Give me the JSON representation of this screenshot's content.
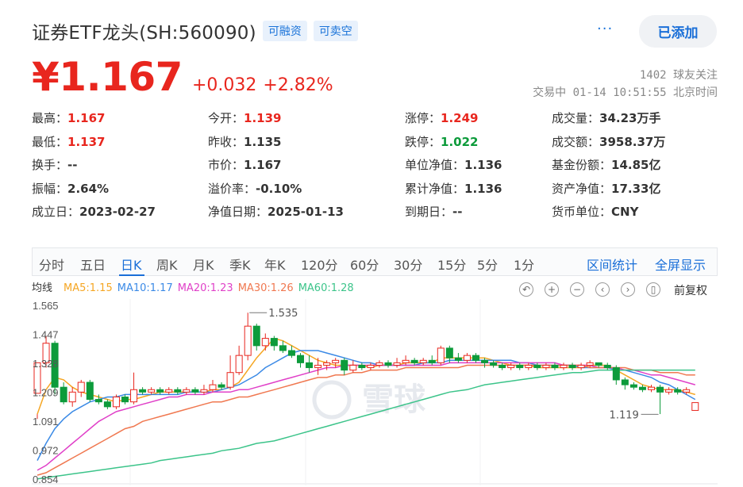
{
  "header": {
    "title": "证券ETF龙头(SH:560090)",
    "tags": [
      "可融资",
      "可卖空"
    ],
    "more": "···",
    "added_label": "已添加",
    "price": "¥1.167",
    "change": "+0.032",
    "change_pct": "+2.82%",
    "followers": "1402 球友关注",
    "status_time": "交易中 01-14 10:51:55 北京时间"
  },
  "stats": [
    {
      "label": "最高：",
      "value": "1.167",
      "color": "up"
    },
    {
      "label": "今开：",
      "value": "1.139",
      "color": "up"
    },
    {
      "label": "涨停：",
      "value": "1.249",
      "color": "up"
    },
    {
      "label": "成交量：",
      "value": "34.23万手",
      "color": ""
    },
    {
      "label": "最低：",
      "value": "1.137",
      "color": "up"
    },
    {
      "label": "昨收：",
      "value": "1.135",
      "color": ""
    },
    {
      "label": "跌停：",
      "value": "1.022",
      "color": "down"
    },
    {
      "label": "成交额：",
      "value": "3958.37万",
      "color": ""
    },
    {
      "label": "换手：",
      "value": "--",
      "color": ""
    },
    {
      "label": "市价：",
      "value": "1.167",
      "color": ""
    },
    {
      "label": "单位净值：",
      "value": "1.136",
      "color": ""
    },
    {
      "label": "基金份额：",
      "value": "14.85亿",
      "color": ""
    },
    {
      "label": "振幅：",
      "value": "2.64%",
      "color": ""
    },
    {
      "label": "溢价率：",
      "value": "-0.10%",
      "color": ""
    },
    {
      "label": "累计净值：",
      "value": "1.136",
      "color": ""
    },
    {
      "label": "资产净值：",
      "value": "17.33亿",
      "color": ""
    },
    {
      "label": "成立日：",
      "value": "2023-02-27",
      "color": ""
    },
    {
      "label": "净值日期：",
      "value": "2025-01-13",
      "color": ""
    },
    {
      "label": "到期日：",
      "value": "--",
      "color": ""
    },
    {
      "label": "货币单位：",
      "value": "CNY",
      "color": ""
    }
  ],
  "tabs": [
    "分时",
    "五日",
    "日K",
    "周K",
    "月K",
    "季K",
    "年K",
    "120分",
    "60分",
    "30分",
    "15分",
    "5分",
    "1分"
  ],
  "active_tab": 2,
  "tab_actions": [
    "区间统计",
    "全屏显示"
  ],
  "ma_legend": {
    "label": "均线",
    "items": [
      {
        "text": "MA5:1.15",
        "color": "#f5a623"
      },
      {
        "text": "MA10:1.17",
        "color": "#3b8ae6"
      },
      {
        "text": "MA20:1.23",
        "color": "#e040c8"
      },
      {
        "text": "MA30:1.26",
        "color": "#f07850"
      },
      {
        "text": "MA60:1.28",
        "color": "#3cc48a"
      }
    ]
  },
  "chart_tools": [
    "↶",
    "+",
    "−",
    "‹",
    "›",
    "▯"
  ],
  "restore_label": "前复权",
  "watermark": "雪球",
  "colors": {
    "up": "#e8261e",
    "down": "#0d9b3b",
    "accent": "#1a6fd8"
  },
  "chart_data": {
    "type": "candlestick",
    "y_ticks": [
      "1.565",
      "1.447",
      "1.328",
      "1.209",
      "1.091",
      "0.972",
      "0.854"
    ],
    "y_tick_values": [
      1.565,
      1.447,
      1.328,
      1.209,
      1.091,
      0.972,
      0.854
    ],
    "ylim": [
      0.854,
      1.565
    ],
    "annotations": [
      {
        "text": "1.535",
        "value": 1.535,
        "candle": 24
      },
      {
        "text": "1.119",
        "value": 1.119,
        "candle": 71
      }
    ],
    "candles": [
      [
        1.205,
        1.33,
        1.12,
        1.1
      ],
      [
        1.33,
        1.41,
        1.44,
        1.31
      ],
      [
        1.41,
        1.23,
        1.42,
        1.2
      ],
      [
        1.23,
        1.17,
        1.25,
        1.16
      ],
      [
        1.17,
        1.21,
        1.23,
        1.15
      ],
      [
        1.21,
        1.25,
        1.26,
        1.19
      ],
      [
        1.25,
        1.18,
        1.26,
        1.17
      ],
      [
        1.18,
        1.17,
        1.2,
        1.16
      ],
      [
        1.17,
        1.15,
        1.18,
        1.14
      ],
      [
        1.15,
        1.19,
        1.2,
        1.14
      ],
      [
        1.19,
        1.17,
        1.2,
        1.16
      ],
      [
        1.17,
        1.22,
        1.29,
        1.16
      ],
      [
        1.22,
        1.21,
        1.23,
        1.2
      ],
      [
        1.21,
        1.22,
        1.23,
        1.2
      ],
      [
        1.22,
        1.21,
        1.23,
        1.2
      ],
      [
        1.21,
        1.22,
        1.23,
        1.2
      ],
      [
        1.22,
        1.21,
        1.23,
        1.2
      ],
      [
        1.21,
        1.22,
        1.23,
        1.2
      ],
      [
        1.22,
        1.21,
        1.23,
        1.2
      ],
      [
        1.21,
        1.22,
        1.24,
        1.2
      ],
      [
        1.22,
        1.24,
        1.26,
        1.21
      ],
      [
        1.24,
        1.23,
        1.25,
        1.22
      ],
      [
        1.23,
        1.29,
        1.36,
        1.22
      ],
      [
        1.29,
        1.36,
        1.4,
        1.28
      ],
      [
        1.36,
        1.48,
        1.535,
        1.34
      ],
      [
        1.48,
        1.4,
        1.49,
        1.38
      ],
      [
        1.4,
        1.43,
        1.45,
        1.38
      ],
      [
        1.43,
        1.4,
        1.44,
        1.38
      ],
      [
        1.4,
        1.38,
        1.42,
        1.37
      ],
      [
        1.38,
        1.36,
        1.4,
        1.35
      ],
      [
        1.36,
        1.33,
        1.37,
        1.31
      ],
      [
        1.33,
        1.31,
        1.36,
        1.29
      ],
      [
        1.31,
        1.32,
        1.35,
        1.28
      ],
      [
        1.32,
        1.33,
        1.34,
        1.3
      ],
      [
        1.33,
        1.34,
        1.35,
        1.31
      ],
      [
        1.34,
        1.3,
        1.35,
        1.28
      ],
      [
        1.3,
        1.32,
        1.34,
        1.29
      ],
      [
        1.32,
        1.31,
        1.33,
        1.3
      ],
      [
        1.31,
        1.32,
        1.33,
        1.3
      ],
      [
        1.32,
        1.33,
        1.34,
        1.31
      ],
      [
        1.33,
        1.32,
        1.34,
        1.31
      ],
      [
        1.32,
        1.33,
        1.35,
        1.31
      ],
      [
        1.33,
        1.34,
        1.36,
        1.32
      ],
      [
        1.34,
        1.33,
        1.35,
        1.32
      ],
      [
        1.33,
        1.34,
        1.35,
        1.32
      ],
      [
        1.34,
        1.33,
        1.36,
        1.32
      ],
      [
        1.33,
        1.39,
        1.4,
        1.32
      ],
      [
        1.39,
        1.35,
        1.4,
        1.33
      ],
      [
        1.35,
        1.34,
        1.37,
        1.33
      ],
      [
        1.34,
        1.36,
        1.37,
        1.33
      ],
      [
        1.36,
        1.34,
        1.37,
        1.33
      ],
      [
        1.34,
        1.33,
        1.35,
        1.31
      ],
      [
        1.33,
        1.32,
        1.34,
        1.31
      ],
      [
        1.32,
        1.31,
        1.33,
        1.3
      ],
      [
        1.31,
        1.32,
        1.33,
        1.3
      ],
      [
        1.32,
        1.31,
        1.33,
        1.3
      ],
      [
        1.31,
        1.32,
        1.33,
        1.3
      ],
      [
        1.32,
        1.31,
        1.33,
        1.3
      ],
      [
        1.31,
        1.32,
        1.33,
        1.3
      ],
      [
        1.32,
        1.31,
        1.33,
        1.3
      ],
      [
        1.31,
        1.32,
        1.33,
        1.3
      ],
      [
        1.32,
        1.31,
        1.33,
        1.3
      ],
      [
        1.31,
        1.32,
        1.33,
        1.3
      ],
      [
        1.32,
        1.33,
        1.34,
        1.31
      ],
      [
        1.33,
        1.32,
        1.33,
        1.31
      ],
      [
        1.32,
        1.31,
        1.33,
        1.3
      ],
      [
        1.31,
        1.26,
        1.32,
        1.24
      ],
      [
        1.26,
        1.24,
        1.27,
        1.22
      ],
      [
        1.24,
        1.23,
        1.25,
        1.22
      ],
      [
        1.23,
        1.22,
        1.24,
        1.21
      ],
      [
        1.22,
        1.23,
        1.24,
        1.21
      ],
      [
        1.23,
        1.21,
        1.24,
        1.12
      ],
      [
        1.21,
        1.22,
        1.23,
        1.2
      ],
      [
        1.22,
        1.21,
        1.23,
        1.2
      ],
      [
        1.21,
        1.22,
        1.23,
        1.2
      ],
      [
        1.135,
        1.167,
        1.167,
        1.137
      ]
    ],
    "series": [
      {
        "name": "MA5",
        "color": "#f5a623",
        "values": [
          1.12,
          1.22,
          1.27,
          1.26,
          1.23,
          1.21,
          1.2,
          1.19,
          1.18,
          1.17,
          1.18,
          1.18,
          1.19,
          1.2,
          1.21,
          1.21,
          1.21,
          1.21,
          1.21,
          1.21,
          1.22,
          1.22,
          1.23,
          1.25,
          1.3,
          1.35,
          1.39,
          1.43,
          1.42,
          1.4,
          1.38,
          1.36,
          1.34,
          1.33,
          1.32,
          1.32,
          1.32,
          1.32,
          1.31,
          1.32,
          1.32,
          1.32,
          1.33,
          1.33,
          1.33,
          1.33,
          1.35,
          1.35,
          1.35,
          1.35,
          1.35,
          1.35,
          1.34,
          1.33,
          1.32,
          1.32,
          1.32,
          1.31,
          1.31,
          1.31,
          1.31,
          1.31,
          1.31,
          1.32,
          1.32,
          1.32,
          1.3,
          1.28,
          1.26,
          1.24,
          1.23,
          1.22,
          1.22,
          1.22,
          1.21,
          1.2
        ]
      },
      {
        "name": "MA10",
        "color": "#3b8ae6",
        "values": [
          0.93,
          1.0,
          1.06,
          1.1,
          1.13,
          1.15,
          1.17,
          1.18,
          1.19,
          1.19,
          1.2,
          1.2,
          1.2,
          1.2,
          1.2,
          1.2,
          1.2,
          1.21,
          1.21,
          1.21,
          1.21,
          1.22,
          1.23,
          1.24,
          1.26,
          1.28,
          1.31,
          1.33,
          1.35,
          1.37,
          1.38,
          1.38,
          1.38,
          1.37,
          1.36,
          1.35,
          1.34,
          1.33,
          1.33,
          1.32,
          1.32,
          1.32,
          1.32,
          1.32,
          1.33,
          1.33,
          1.33,
          1.34,
          1.34,
          1.34,
          1.34,
          1.34,
          1.34,
          1.34,
          1.34,
          1.33,
          1.33,
          1.32,
          1.32,
          1.32,
          1.32,
          1.32,
          1.31,
          1.31,
          1.31,
          1.31,
          1.3,
          1.3,
          1.29,
          1.28,
          1.27,
          1.25,
          1.24,
          1.22,
          1.2,
          1.18
        ]
      },
      {
        "name": "MA20",
        "color": "#e040c8",
        "values": [
          0.89,
          0.91,
          0.94,
          0.97,
          1.0,
          1.03,
          1.06,
          1.09,
          1.11,
          1.13,
          1.14,
          1.15,
          1.16,
          1.17,
          1.18,
          1.19,
          1.19,
          1.2,
          1.2,
          1.2,
          1.21,
          1.21,
          1.21,
          1.22,
          1.22,
          1.23,
          1.24,
          1.25,
          1.26,
          1.27,
          1.28,
          1.29,
          1.3,
          1.31,
          1.31,
          1.32,
          1.32,
          1.32,
          1.32,
          1.32,
          1.32,
          1.32,
          1.32,
          1.32,
          1.32,
          1.32,
          1.32,
          1.33,
          1.33,
          1.33,
          1.33,
          1.33,
          1.33,
          1.33,
          1.33,
          1.33,
          1.33,
          1.33,
          1.33,
          1.33,
          1.32,
          1.32,
          1.32,
          1.32,
          1.31,
          1.31,
          1.31,
          1.3,
          1.3,
          1.29,
          1.28,
          1.28,
          1.27,
          1.26,
          1.25,
          1.24
        ]
      },
      {
        "name": "MA30",
        "color": "#f07850",
        "values": [
          0.87,
          0.88,
          0.9,
          0.92,
          0.94,
          0.96,
          0.98,
          1.0,
          1.02,
          1.04,
          1.06,
          1.07,
          1.09,
          1.1,
          1.11,
          1.12,
          1.13,
          1.14,
          1.15,
          1.16,
          1.17,
          1.17,
          1.18,
          1.19,
          1.19,
          1.2,
          1.21,
          1.22,
          1.23,
          1.24,
          1.25,
          1.26,
          1.27,
          1.27,
          1.28,
          1.28,
          1.29,
          1.29,
          1.3,
          1.3,
          1.3,
          1.3,
          1.31,
          1.31,
          1.31,
          1.31,
          1.31,
          1.31,
          1.31,
          1.32,
          1.32,
          1.32,
          1.32,
          1.32,
          1.32,
          1.32,
          1.32,
          1.32,
          1.32,
          1.32,
          1.32,
          1.32,
          1.32,
          1.31,
          1.31,
          1.31,
          1.31,
          1.31,
          1.3,
          1.3,
          1.3,
          1.29,
          1.29,
          1.29,
          1.28,
          1.28
        ]
      },
      {
        "name": "MA60",
        "color": "#3cc48a",
        "values": [
          0.855,
          0.86,
          0.865,
          0.87,
          0.875,
          0.88,
          0.885,
          0.89,
          0.895,
          0.9,
          0.905,
          0.91,
          0.915,
          0.92,
          0.93,
          0.935,
          0.94,
          0.945,
          0.95,
          0.955,
          0.96,
          0.97,
          0.975,
          0.98,
          0.99,
          1.0,
          1.005,
          1.01,
          1.02,
          1.03,
          1.04,
          1.05,
          1.06,
          1.07,
          1.08,
          1.09,
          1.1,
          1.11,
          1.12,
          1.13,
          1.14,
          1.15,
          1.16,
          1.17,
          1.18,
          1.19,
          1.2,
          1.21,
          1.215,
          1.22,
          1.23,
          1.24,
          1.245,
          1.25,
          1.255,
          1.26,
          1.265,
          1.27,
          1.275,
          1.28,
          1.285,
          1.29,
          1.29,
          1.295,
          1.3,
          1.3,
          1.3,
          1.3,
          1.3,
          1.3,
          1.3,
          1.3,
          1.3,
          1.3,
          1.3,
          1.3
        ]
      }
    ]
  }
}
